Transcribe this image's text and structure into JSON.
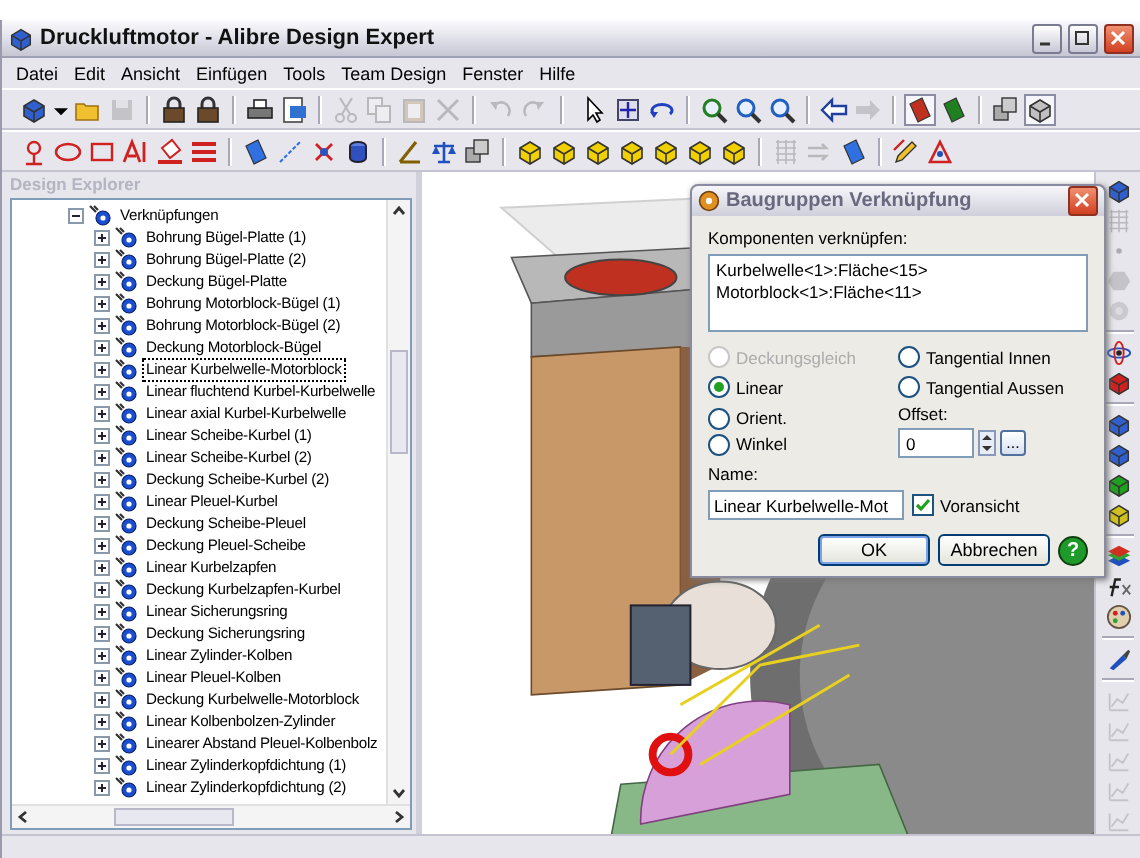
{
  "window": {
    "title": "Druckluftmotor - Alibre Design Expert"
  },
  "menu": [
    "Datei",
    "Edit",
    "Ansicht",
    "Einfügen",
    "Tools",
    "Team Design",
    "Fenster",
    "Hilfe"
  ],
  "toolbars": [
    [
      {
        "disabled": false,
        "pressed": false
      },
      {
        "disabled": false,
        "pressed": false
      },
      {
        "disabled": false,
        "pressed": false
      },
      {
        "disabled": true,
        "pressed": false
      },
      {
        "disabled": false,
        "pressed": false
      },
      {
        "disabled": false,
        "pressed": false
      },
      {
        "disabled": false,
        "pressed": false
      },
      {
        "disabled": false,
        "pressed": false
      },
      {
        "disabled": true,
        "pressed": false
      },
      {
        "disabled": true,
        "pressed": false
      },
      {
        "disabled": true,
        "pressed": false
      },
      {
        "disabled": true,
        "pressed": false
      },
      {
        "disabled": true,
        "pressed": false
      },
      {
        "disabled": true,
        "pressed": false
      },
      {
        "disabled": false,
        "pressed": false
      },
      {
        "disabled": false,
        "pressed": false
      },
      {
        "disabled": false,
        "pressed": false
      },
      {
        "disabled": false,
        "pressed": false
      },
      {
        "disabled": false,
        "pressed": false
      },
      {
        "disabled": false,
        "pressed": false
      },
      {
        "disabled": false,
        "pressed": false
      },
      {
        "disabled": true,
        "pressed": false
      },
      {
        "disabled": false,
        "pressed": true
      },
      {
        "disabled": false,
        "pressed": false
      },
      {
        "disabled": false,
        "pressed": false
      },
      {
        "disabled": false,
        "pressed": true
      }
    ],
    [
      {
        "disabled": false
      },
      {
        "disabled": false
      },
      {
        "disabled": false
      },
      {
        "disabled": false
      },
      {
        "disabled": false
      },
      {
        "disabled": false
      },
      {
        "disabled": false
      },
      {
        "disabled": false
      },
      {
        "disabled": false
      },
      {
        "disabled": false
      },
      {
        "disabled": false
      },
      {
        "disabled": false
      },
      {
        "disabled": false
      },
      {
        "disabled": false
      },
      {
        "disabled": false
      },
      {
        "disabled": false
      },
      {
        "disabled": false
      },
      {
        "disabled": false
      },
      {
        "disabled": false
      },
      {
        "disabled": false
      },
      {
        "disabled": true
      },
      {
        "disabled": true
      },
      {
        "disabled": false
      },
      {
        "disabled": false
      },
      {
        "disabled": false
      }
    ]
  ],
  "side_toolbar": [
    {
      "disabled": false
    },
    {
      "disabled": true
    },
    {
      "disabled": true
    },
    {
      "disabled": true
    },
    {
      "disabled": true
    },
    {
      "disabled": false
    },
    {
      "disabled": false
    },
    {
      "disabled": false
    },
    {
      "disabled": false
    },
    {
      "disabled": false
    },
    {
      "disabled": false
    },
    {
      "disabled": false
    },
    {
      "disabled": false
    },
    {
      "disabled": false
    },
    {
      "disabled": false
    },
    {
      "disabled": true
    },
    {
      "disabled": true
    },
    {
      "disabled": true
    },
    {
      "disabled": true
    },
    {
      "disabled": true
    }
  ],
  "explorer": {
    "title": "Design Explorer",
    "tree": [
      {
        "label": "Verknüpfungen",
        "expanded": true,
        "selected": false,
        "children": [
          {
            "label": "Bohrung Bügel-Platte (1)",
            "expanded": false,
            "selected": false
          },
          {
            "label": "Bohrung Bügel-Platte (2)",
            "expanded": false,
            "selected": false
          },
          {
            "label": "Deckung Bügel-Platte",
            "expanded": false,
            "selected": false
          },
          {
            "label": "Bohrung Motorblock-Bügel (1)",
            "expanded": false,
            "selected": false
          },
          {
            "label": "Bohrung Motorblock-Bügel (2)",
            "expanded": false,
            "selected": false
          },
          {
            "label": "Deckung Motorblock-Bügel",
            "expanded": false,
            "selected": false
          },
          {
            "label": "Linear Kurbelwelle-Motorblock",
            "expanded": false,
            "selected": true
          },
          {
            "label": "Linear fluchtend Kurbel-Kurbelwelle",
            "expanded": false,
            "selected": false
          },
          {
            "label": "Linear axial Kurbel-Kurbelwelle",
            "expanded": false,
            "selected": false
          },
          {
            "label": "Linear Scheibe-Kurbel (1)",
            "expanded": false,
            "selected": false
          },
          {
            "label": "Linear Scheibe-Kurbel (2)",
            "expanded": false,
            "selected": false
          },
          {
            "label": "Deckung Scheibe-Kurbel (2)",
            "expanded": false,
            "selected": false
          },
          {
            "label": "Linear Pleuel-Kurbel",
            "expanded": false,
            "selected": false
          },
          {
            "label": "Deckung Scheibe-Pleuel",
            "expanded": false,
            "selected": false
          },
          {
            "label": "Deckung Pleuel-Scheibe",
            "expanded": false,
            "selected": false
          },
          {
            "label": "Linear Kurbelzapfen",
            "expanded": false,
            "selected": false
          },
          {
            "label": "Deckung Kurbelzapfen-Kurbel",
            "expanded": false,
            "selected": false
          },
          {
            "label": "Linear  Sicherungsring",
            "expanded": false,
            "selected": false
          },
          {
            "label": "Deckung Sicherungsring",
            "expanded": false,
            "selected": false
          },
          {
            "label": "Linear Zylinder-Kolben",
            "expanded": false,
            "selected": false
          },
          {
            "label": "Linear Pleuel-Kolben",
            "expanded": false,
            "selected": false
          },
          {
            "label": "Deckung Kurbelwelle-Motorblock",
            "expanded": false,
            "selected": false
          },
          {
            "label": "Linear Kolbenbolzen-Zylinder",
            "expanded": false,
            "selected": false
          },
          {
            "label": "Linearer Abstand Pleuel-Kolbenbolz",
            "expanded": false,
            "selected": false
          },
          {
            "label": "Linear Zylinderkopfdichtung (1)",
            "expanded": false,
            "selected": false
          },
          {
            "label": "Linear Zylinderkopfdichtung (2)",
            "expanded": false,
            "selected": false
          }
        ]
      }
    ]
  },
  "dialog": {
    "title": "Baugruppen Verknüpfung",
    "components_label": "Komponenten verknüpfen:",
    "components": [
      "Kurbelwelle<1>:Fläche<15>",
      "Motorblock<1>:Fläche<11>"
    ],
    "options": [
      {
        "label": "Deckungsgleich",
        "selected": false,
        "disabled": true
      },
      {
        "label": "Tangential Innen",
        "selected": false,
        "disabled": false
      },
      {
        "label": "Linear",
        "selected": true,
        "disabled": false
      },
      {
        "label": "Tangential Aussen",
        "selected": false,
        "disabled": false
      },
      {
        "label": "Orient.",
        "selected": false,
        "disabled": false
      },
      {
        "label": "Winkel",
        "selected": false,
        "disabled": false
      }
    ],
    "offset_label": "Offset:",
    "offset_value": "0",
    "more_button": "...",
    "name_label": "Name:",
    "name_value": "Linear Kurbelwelle-Mot",
    "preview": {
      "label": "Voransicht",
      "checked": true
    },
    "buttons": [
      {
        "label": "OK",
        "default": true
      },
      {
        "label": "Abbrechen",
        "default": false
      }
    ],
    "help": "?"
  }
}
